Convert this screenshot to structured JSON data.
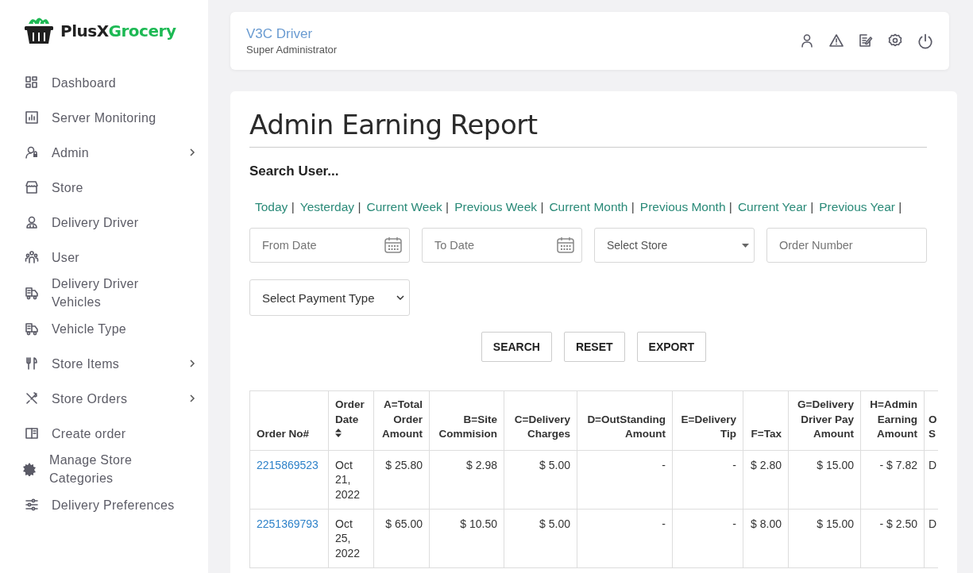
{
  "logo": {
    "part_1": "PlusX",
    "part_2": "Grocery"
  },
  "sidebar": {
    "items": [
      {
        "label": "Dashboard",
        "has_submenu": false
      },
      {
        "label": "Server Monitoring",
        "has_submenu": false
      },
      {
        "label": "Admin",
        "has_submenu": true
      },
      {
        "label": "Store",
        "has_submenu": false
      },
      {
        "label": "Delivery Driver",
        "has_submenu": false
      },
      {
        "label": "User",
        "has_submenu": false
      },
      {
        "label": "Delivery Driver Vehicles",
        "has_submenu": false
      },
      {
        "label": "Vehicle Type",
        "has_submenu": false
      },
      {
        "label": "Store Items",
        "has_submenu": true
      },
      {
        "label": "Store Orders",
        "has_submenu": true
      },
      {
        "label": "Create order",
        "has_submenu": false
      },
      {
        "label": "Manage Store Categories",
        "has_submenu": false
      },
      {
        "label": "Delivery Preferences",
        "has_submenu": false
      }
    ]
  },
  "header": {
    "user_name": "V3C Driver",
    "role": "Super Administrator"
  },
  "report": {
    "title": "Admin Earning Report",
    "search_label": "Search User...",
    "quick_filters": [
      {
        "label": "Today",
        "separator": "|"
      },
      {
        "label": "Yesterday",
        "separator": "|"
      },
      {
        "label": "Current Week",
        "separator": "|"
      },
      {
        "label": "Previous Week",
        "separator": "|"
      },
      {
        "label": "Current Month",
        "separator": "|"
      },
      {
        "label": "Previous Month",
        "separator": "|"
      },
      {
        "label": "Current Year",
        "separator": "|"
      },
      {
        "label": "Previous Year",
        "separator": "|"
      }
    ],
    "from_date": {
      "placeholder": "From Date"
    },
    "to_date": {
      "placeholder": "To Date"
    },
    "store_select": {
      "value": "Select Store"
    },
    "order_number": {
      "placeholder": "Order Number"
    },
    "payment_select": {
      "value": "Select Payment Type"
    },
    "buttons": [
      "SEARCH",
      "RESET",
      "EXPORT"
    ],
    "table": {
      "columns": [
        {
          "label": "Order No#",
          "sortable": false
        },
        {
          "label": "Order Date",
          "sortable": true
        },
        {
          "label": "A=Total Order Amount",
          "sortable": false
        },
        {
          "label": "B=Site Commision",
          "sortable": false
        },
        {
          "label": "C=Delivery Charges",
          "sortable": false
        },
        {
          "label": "D=OutStanding Amount",
          "sortable": false
        },
        {
          "label": "E=Delivery Tip",
          "sortable": false
        },
        {
          "label": "F=Tax",
          "sortable": false
        },
        {
          "label": "G=Delivery Driver Pay Amount",
          "sortable": false
        },
        {
          "label": "H=Admin Earning Amount",
          "sortable": false
        },
        {
          "label": "O S",
          "sortable": false
        }
      ],
      "rows": [
        [
          "2215869523",
          "Oct 21, 2022",
          "$ 25.80",
          "$ 2.98",
          "$ 5.00",
          "-",
          "-",
          "$ 2.80",
          "$ 15.00",
          "- $ 7.82",
          "D"
        ],
        [
          "2251369793",
          "Oct 25, 2022",
          "$ 65.00",
          "$ 10.50",
          "$ 5.00",
          "-",
          "-",
          "$ 8.00",
          "$ 15.00",
          "- $ 2.50",
          "D"
        ]
      ]
    }
  }
}
